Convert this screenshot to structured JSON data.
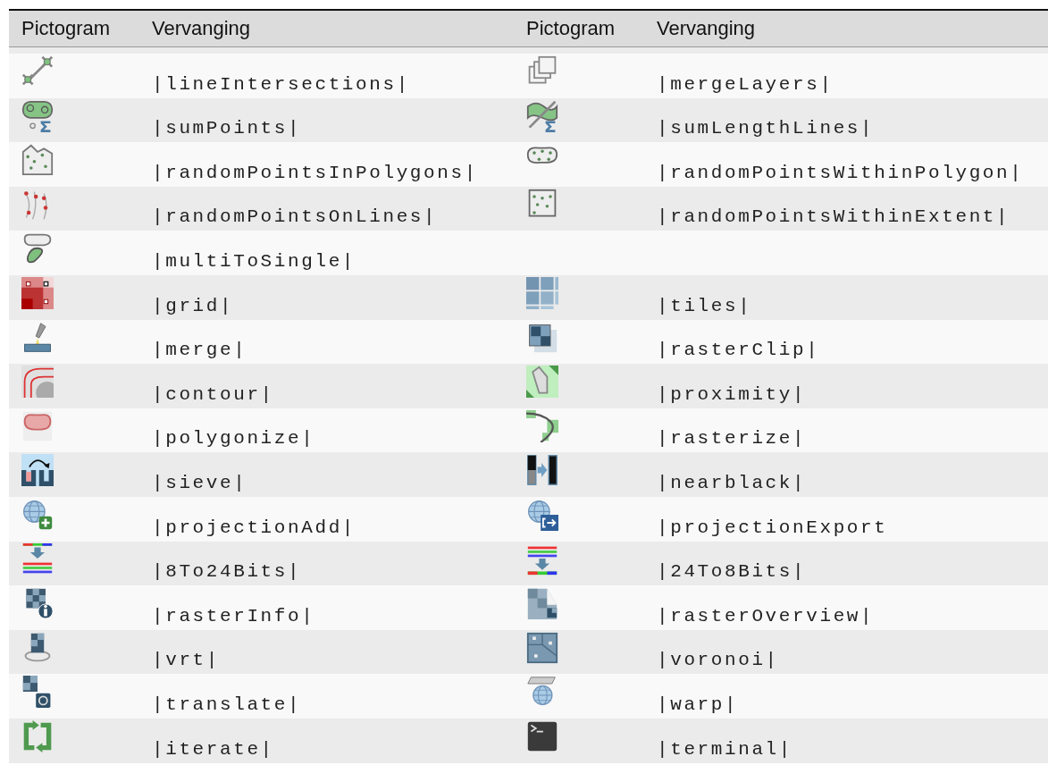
{
  "table": {
    "columns": [
      "Pictogram",
      "Vervanging",
      "Pictogram",
      "Vervanging"
    ],
    "rows": [
      {
        "left": "|lineIntersections|",
        "right": "|mergeLayers|"
      },
      {
        "left": "|sumPoints|",
        "right": "|sumLengthLines|"
      },
      {
        "left": "|randomPointsInPolygons|",
        "right": "|randomPointsWithinPolygon|"
      },
      {
        "left": "|randomPointsOnLines|",
        "right": "|randomPointsWithinExtent|"
      },
      {
        "left": "|multiToSingle|"
      },
      {
        "left": "|grid|",
        "right": "|tiles|"
      },
      {
        "left": "|merge|",
        "right": "|rasterClip|"
      },
      {
        "left": "|contour|",
        "right": "|proximity|"
      },
      {
        "left": "|polygonize|",
        "right": "|rasterize|"
      },
      {
        "left": "|sieve|",
        "right": "|nearblack|"
      },
      {
        "left": "|projectionAdd|",
        "right": "|projectionExport"
      },
      {
        "left": "|8To24Bits|",
        "right": "|24To8Bits|"
      },
      {
        "left": "|rasterInfo|",
        "right": "|rasterOverview|"
      },
      {
        "left": "|vrt|",
        "right": "|voronoi|"
      },
      {
        "left": "|translate|",
        "right": "|warp|"
      },
      {
        "left": "|iterate|",
        "right": "|terminal|"
      }
    ]
  }
}
